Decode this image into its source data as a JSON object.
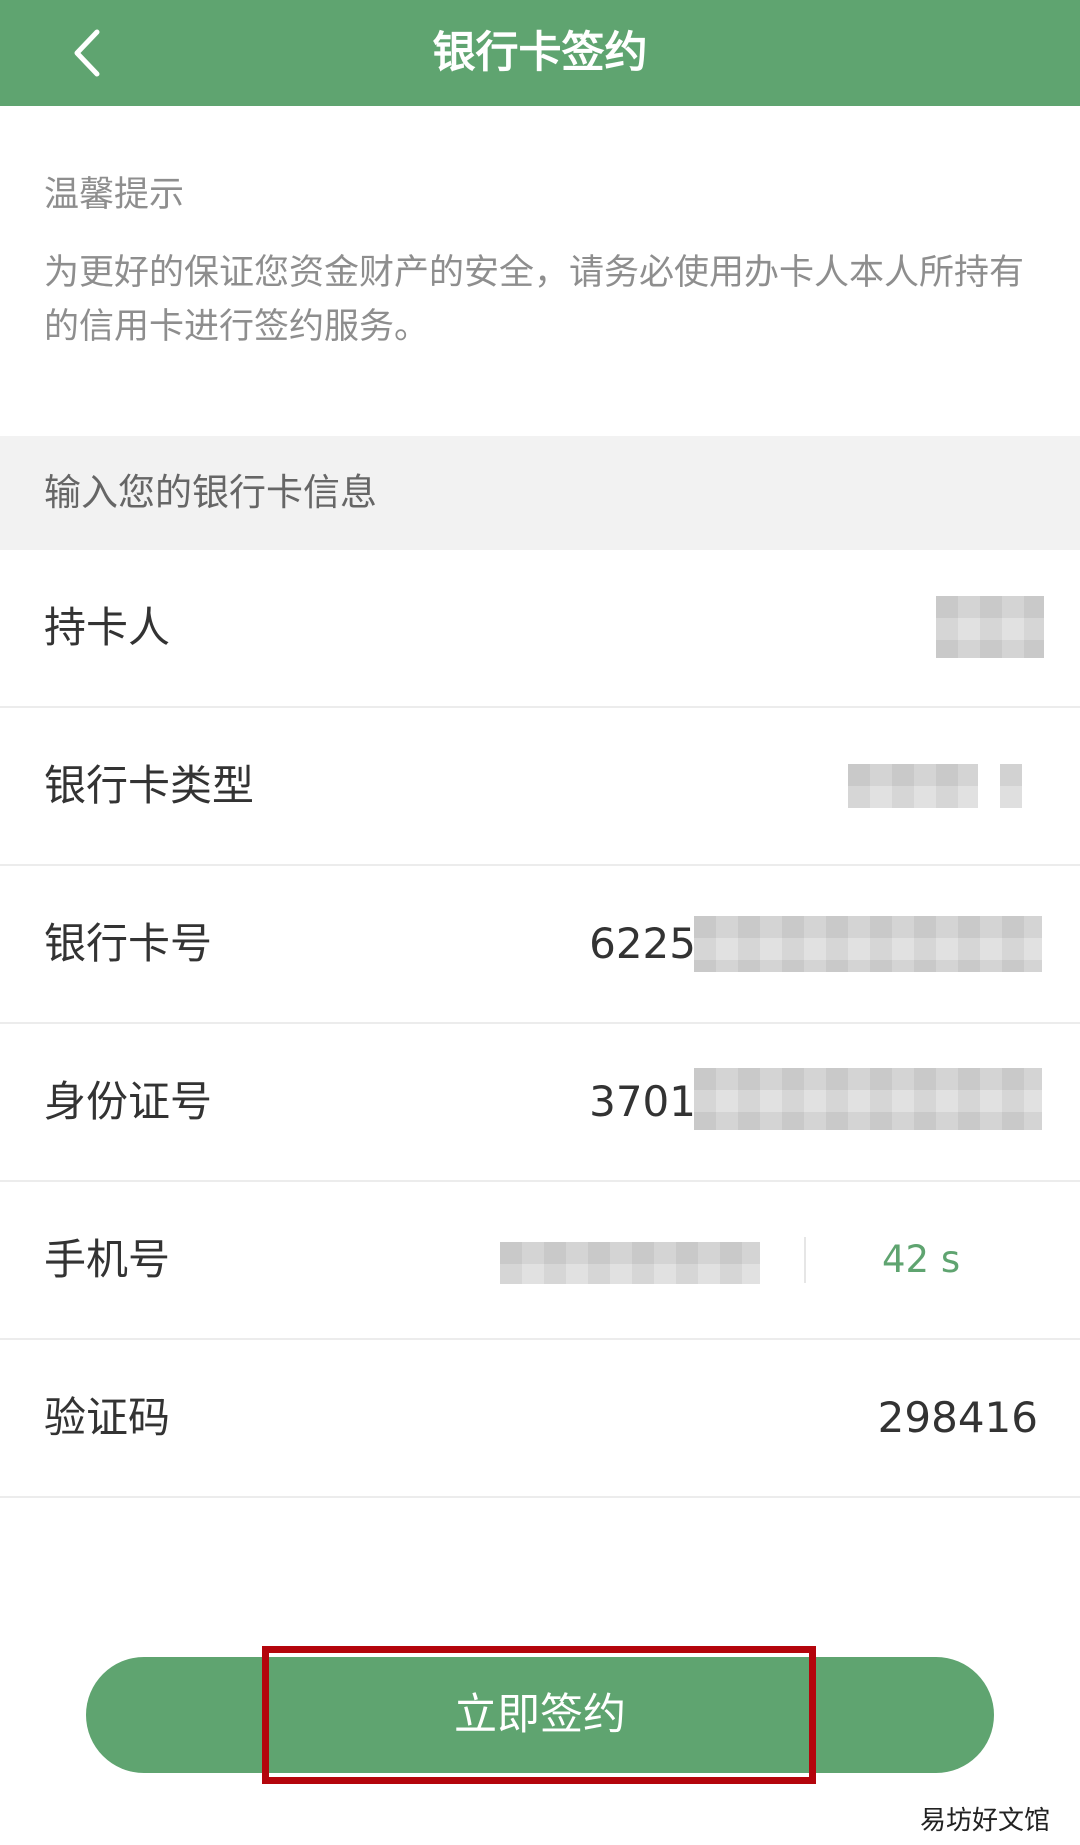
{
  "nav": {
    "title": "银行卡签约"
  },
  "tips": {
    "title": "温馨提示",
    "text": "为更好的保证您资金财产的安全，请务必使用办卡人本人所持有的信用卡进行签约服务。"
  },
  "section": {
    "title": "输入您的银行卡信息"
  },
  "rows": {
    "holder": {
      "label": "持卡人"
    },
    "card_type": {
      "label": "银行卡类型"
    },
    "card_number": {
      "label": "银行卡号",
      "value_prefix": "6225"
    },
    "id_number": {
      "label": "身份证号",
      "value_prefix": "3701"
    },
    "phone": {
      "label": "手机号",
      "countdown": "42 s"
    },
    "code": {
      "label": "验证码",
      "value": "298416"
    }
  },
  "button": {
    "submit_label": "立即签约"
  },
  "watermark": "易坊好文馆",
  "colors": {
    "brand_green": "#5fa470",
    "highlight_red": "#b4050c",
    "section_bg": "#f2f2f2",
    "tip_gray": "#8e8e8e"
  }
}
